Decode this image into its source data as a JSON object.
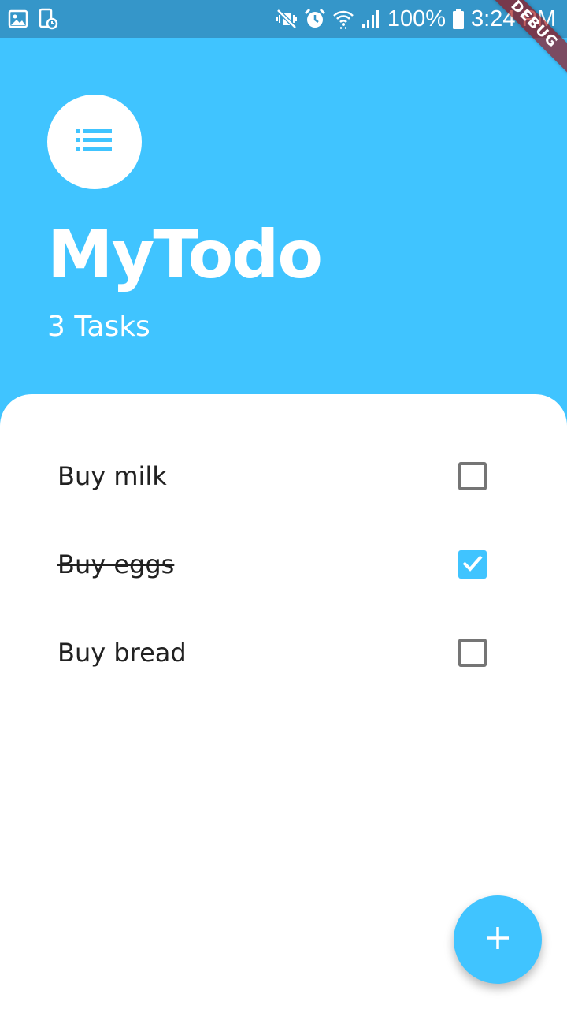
{
  "status_bar": {
    "battery": "100%",
    "time": "3:24 PM",
    "icons_left": [
      "gallery-icon",
      "screen-time-icon"
    ],
    "icons_right": [
      "vibrate-mute-icon",
      "alarm-icon",
      "wifi-icon",
      "signal-icon",
      "battery-icon"
    ]
  },
  "debug_banner": "DEBUG",
  "header": {
    "icon": "list-icon",
    "title": "MyTodo",
    "task_count": "3 Tasks"
  },
  "todos": [
    {
      "label": "Buy milk",
      "done": false
    },
    {
      "label": "Buy eggs",
      "done": true
    },
    {
      "label": "Buy bread",
      "done": false
    }
  ],
  "fab": {
    "icon": "plus-icon"
  },
  "colors": {
    "primary": "#40C4FF",
    "status_bar": "#3596C9",
    "text": "#212121",
    "checkbox_border": "#757575"
  }
}
